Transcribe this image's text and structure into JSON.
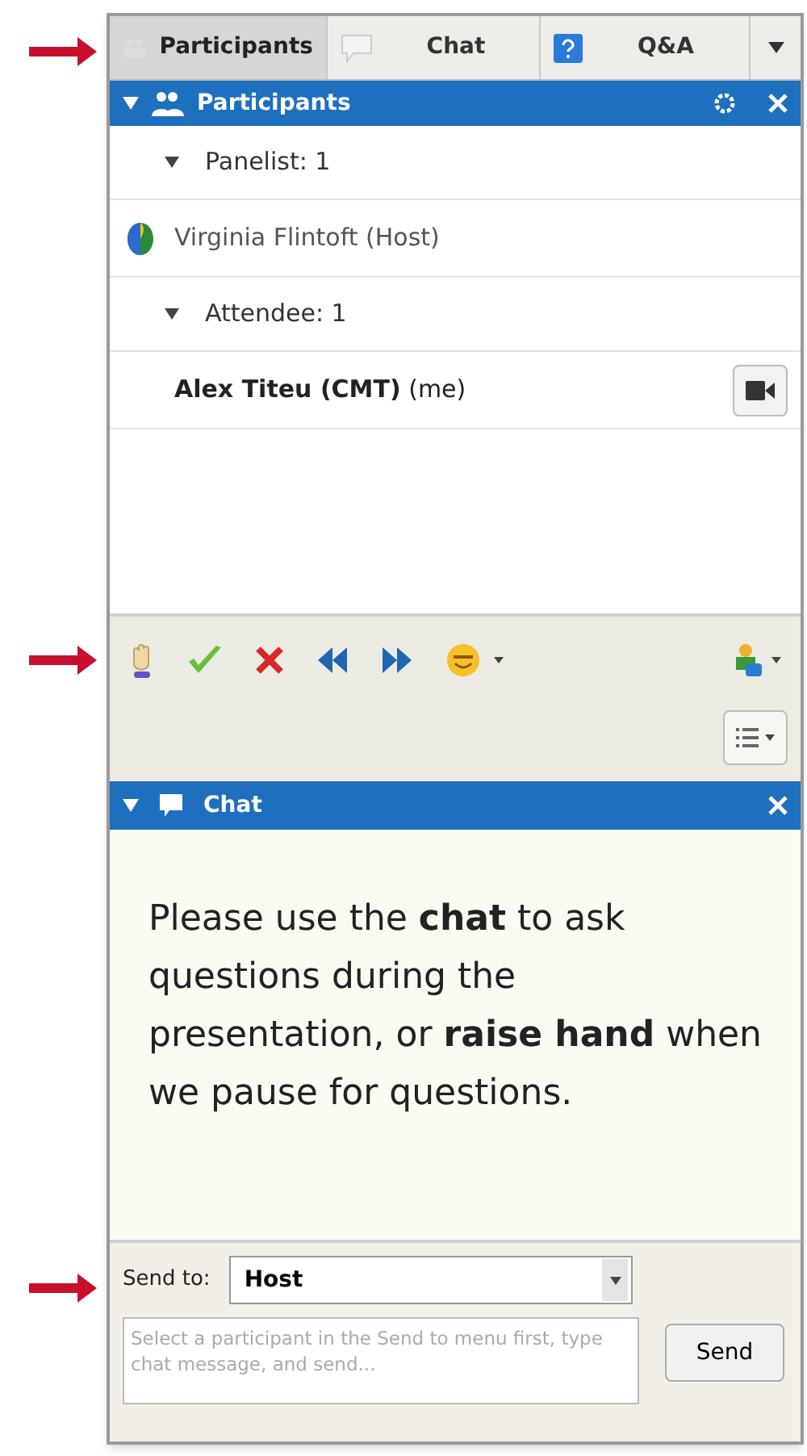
{
  "tabs": [
    {
      "label": "Participants",
      "selected": true
    },
    {
      "label": "Chat",
      "selected": false
    },
    {
      "label": "Q&A",
      "selected": false
    }
  ],
  "participants_panel": {
    "title": "Participants",
    "groups": [
      {
        "label": "Panelist: 1",
        "expanded": true,
        "children": [
          {
            "name": "Virginia Flintoft (Host)",
            "is_me": false
          }
        ]
      },
      {
        "label": "Attendee: 1",
        "expanded": true,
        "children": [
          {
            "name": "**Alex Titeu (CMT)** (me)",
            "is_me": true
          }
        ]
      }
    ]
  },
  "chat_panel": {
    "title": "Chat",
    "message": "Please use the **chat** to ask questions during the presentation, or **raise hand** when we pause for questions.",
    "send_to": {
      "label": "Send to:",
      "value": "Host"
    },
    "message_field": {
      "placeholder": "Select a participant in the Send to menu first, type chat message, and send..."
    },
    "send_button": "Send"
  }
}
